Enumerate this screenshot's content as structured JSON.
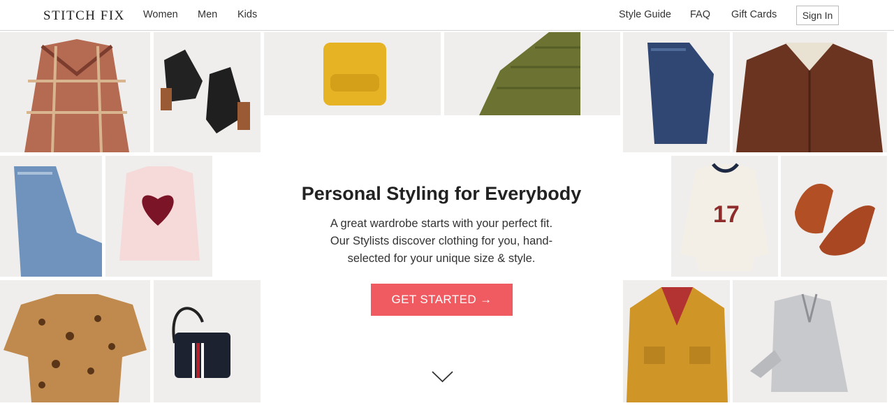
{
  "header": {
    "logo": "STITCH FIX",
    "nav_left": [
      "Women",
      "Men",
      "Kids"
    ],
    "nav_right": [
      "Style Guide",
      "FAQ",
      "Gift Cards"
    ],
    "sign_in": "Sign In"
  },
  "hero": {
    "title": "Personal Styling for Everybody",
    "lines": [
      "A great wardrobe starts with your perfect fit.",
      "Our Stylists discover clothing for you, hand-",
      "selected for your unique size & style."
    ],
    "cta": "GET STARTED →"
  },
  "colors": {
    "accent": "#ef5b61",
    "tile_bg": "#f0eeec"
  },
  "tiles": [
    "plaid-coat",
    "black-ankle-boots",
    "yellow-sweater",
    "olive-puffer-jacket",
    "dark-jeans",
    "brown-corduroy-jacket",
    "light-jeans",
    "pink-heart-sweater",
    "graphic-tee",
    "brown-sneakers",
    "leopard-blouse",
    "black-crossbody-bag",
    "mustard-shirt-jacket",
    "grey-button-shirt"
  ],
  "icons": {
    "scroll_down": "chevron-down-icon"
  }
}
